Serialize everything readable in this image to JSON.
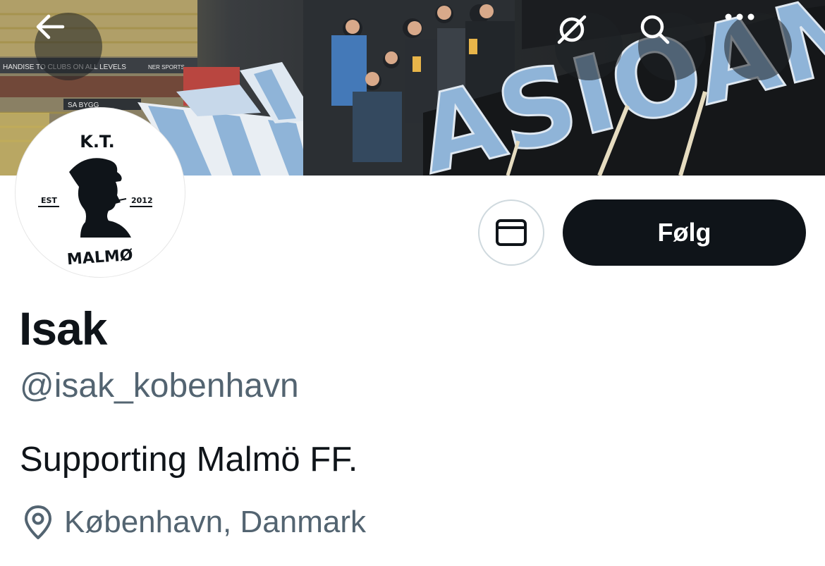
{
  "header": {
    "back_icon": "arrow-left-icon",
    "grok_icon": "slashed-circle-icon",
    "search_icon": "search-icon",
    "more_icon": "more-horizontal-icon",
    "banner_text": {
      "board_1": "HANDISE TO CLUBS ON ALL LEVELS",
      "board_2": "NER SPORTS",
      "board_3": "SA BYGG",
      "banner_letters": "ASIOAN"
    }
  },
  "avatar": {
    "top_text": "K.T.",
    "left_text": "EST",
    "right_text": "2012",
    "bottom_text": "MALMØ"
  },
  "actions": {
    "message_icon": "mail-icon",
    "follow_label": "Følg"
  },
  "profile": {
    "name": "Isak",
    "handle": "@isak_kobenhavn",
    "bio": "Supporting Malmö FF.",
    "location": "København, Danmark",
    "location_icon": "location-pin-icon"
  },
  "colors": {
    "primary_text": "#0f1419",
    "secondary_text": "#536471",
    "button_dark": "#0f1419",
    "border": "#cfd9de",
    "banner_sky_blue": "#8fb4d8"
  }
}
